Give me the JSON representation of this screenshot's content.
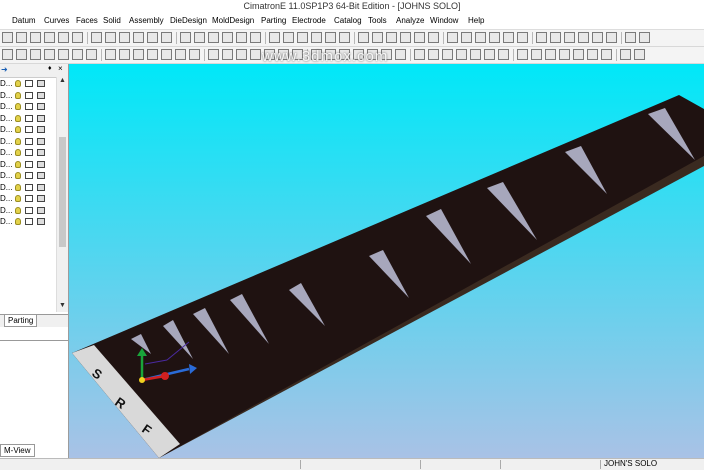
{
  "window": {
    "title": "CimatronE 11.0SP1P3 64-Bit Edition - [JOHNS SOLO]"
  },
  "menu": {
    "items": [
      "Datum",
      "Curves",
      "Faces",
      "Solid",
      "Assembly",
      "DieDesign",
      "MoldDesign",
      "Parting",
      "Electrode",
      "Catalog",
      "Tools",
      "Analyze",
      "Window",
      "Help"
    ]
  },
  "watermark": "www.3dmox.com",
  "tree": {
    "rows": [
      "D...",
      "D...",
      "D...",
      "D...",
      "D...",
      "D...",
      "D...",
      "D...",
      "D...",
      "D...",
      "D...",
      "D...",
      "D..."
    ]
  },
  "tabs": {
    "parting": "Parting",
    "mview": "M-View"
  },
  "status": {
    "user": "JOHN'S SOLO"
  },
  "model": {
    "letters": [
      "S",
      "R",
      "F"
    ]
  },
  "colors": {
    "viewport_top": "#00e8f8",
    "viewport_bottom": "#a9c2e6",
    "plate": "#1f1211",
    "slot": "#a7a7bc"
  }
}
